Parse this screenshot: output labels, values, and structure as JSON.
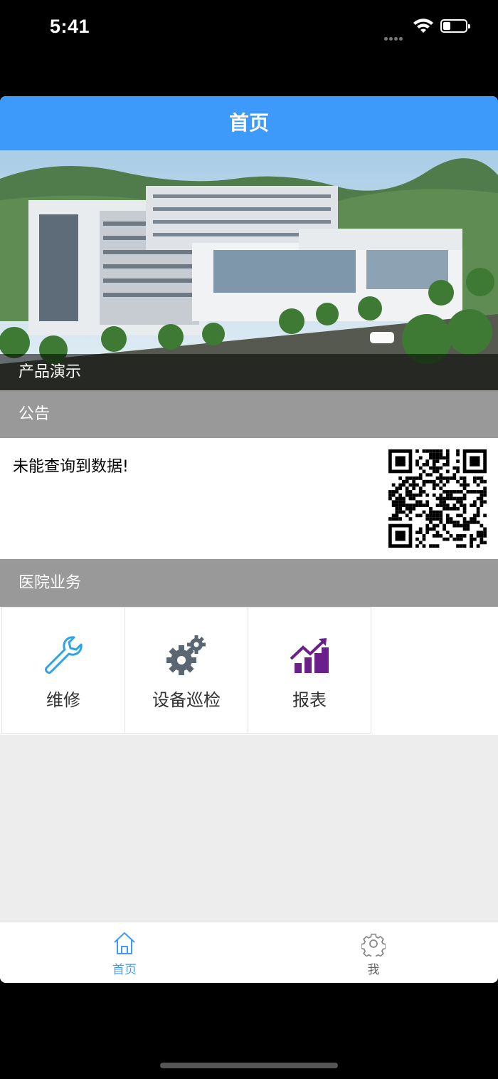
{
  "status_bar": {
    "time": "5:41"
  },
  "navbar": {
    "title": "首页"
  },
  "banner": {
    "caption": "产品演示"
  },
  "notice_section": {
    "header": "公告",
    "message": "未能查询到数据!"
  },
  "business_section": {
    "header": "医院业务",
    "items": [
      {
        "label": "维修",
        "icon": "wrench-icon",
        "color": "#2ea3e6"
      },
      {
        "label": "设备巡检",
        "icon": "gears-icon",
        "color": "#5a6772"
      },
      {
        "label": "报表",
        "icon": "bar-chart-icon",
        "color": "#6a1f8a"
      }
    ]
  },
  "tabbar": {
    "tabs": [
      {
        "label": "首页",
        "icon": "home-icon",
        "active": true,
        "color": "#3e9afa"
      },
      {
        "label": "我",
        "icon": "gear-icon",
        "active": false,
        "color": "#888888"
      }
    ]
  },
  "colors": {
    "accent": "#3e9afa",
    "section_header_bg": "#999999",
    "page_bg": "#ededed"
  }
}
